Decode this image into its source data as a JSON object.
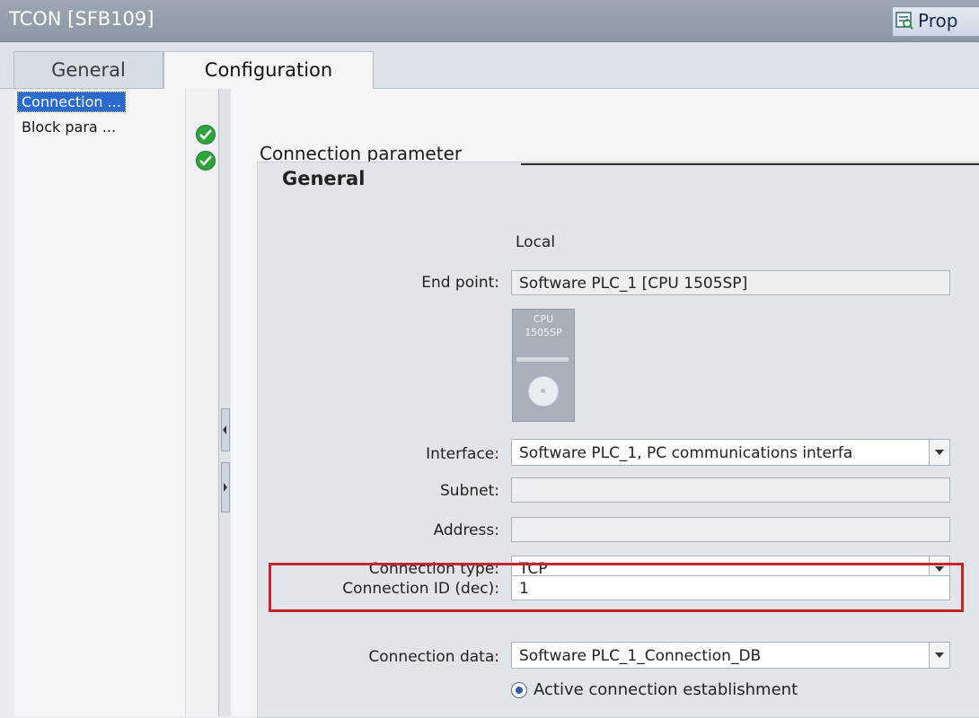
{
  "window": {
    "title": "TCON [SFB109]",
    "properties_label": "Prop"
  },
  "tabs": [
    {
      "label": "General"
    },
    {
      "label": "Configuration"
    }
  ],
  "nav": {
    "items": [
      {
        "label": "Connection ..."
      },
      {
        "label": "Block para ..."
      }
    ]
  },
  "section": {
    "title": "Connection parameter",
    "group_title": "General"
  },
  "form": {
    "local_header": "Local",
    "end_point": {
      "label": "End point:",
      "value": "Software PLC_1 [CPU 1505SP]"
    },
    "device_image_text": [
      "CPU",
      "1505SP"
    ],
    "interface": {
      "label": "Interface:",
      "value": "Software PLC_1, PC communications interfa"
    },
    "subnet": {
      "label": "Subnet:",
      "value": ""
    },
    "address": {
      "label": "Address:",
      "value": ""
    },
    "connection_type": {
      "label": "Connection type:",
      "value": "TCP"
    },
    "connection_id": {
      "label": "Connection ID (dec):",
      "value": "1"
    },
    "connection_data": {
      "label": "Connection data:",
      "value": "Software PLC_1_Connection_DB"
    },
    "active_connection": {
      "label": "Active connection establishment",
      "checked": true
    }
  },
  "colors": {
    "highlight_box": "#c8242e",
    "selection": "#2a6ad1",
    "status_ok": "#2fa43a"
  },
  "icons": [
    "properties-icon",
    "check-icon",
    "chevron-down-icon",
    "radio-icon"
  ]
}
